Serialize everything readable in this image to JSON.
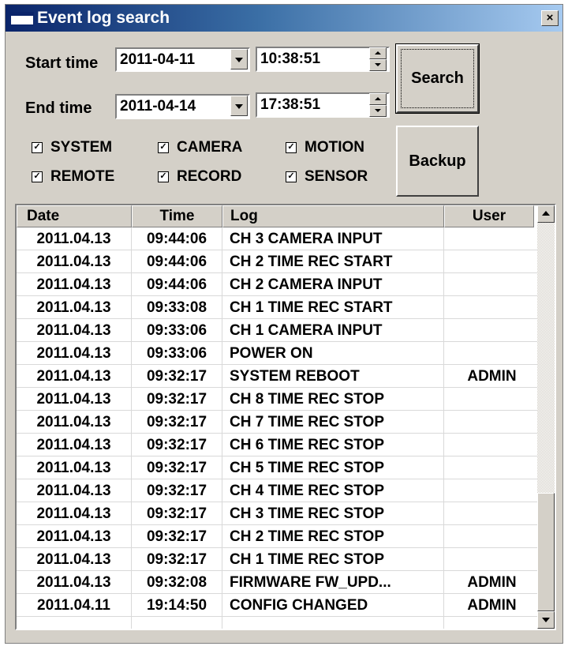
{
  "window": {
    "title": "Event log search",
    "close_label": "×"
  },
  "filters": {
    "start_label": "Start time",
    "start_date": "2011-04-11",
    "start_time": "10:38:51",
    "end_label": "End time",
    "end_date": "2011-04-14",
    "end_time": "17:38:51"
  },
  "buttons": {
    "search": "Search",
    "backup": "Backup"
  },
  "checkboxes": [
    {
      "label": "SYSTEM",
      "checked": true
    },
    {
      "label": "CAMERA",
      "checked": true
    },
    {
      "label": "MOTION",
      "checked": true
    },
    {
      "label": "REMOTE",
      "checked": true
    },
    {
      "label": "RECORD",
      "checked": true
    },
    {
      "label": "SENSOR",
      "checked": true
    }
  ],
  "table": {
    "columns": [
      "Date",
      "Time",
      "Log",
      "User"
    ],
    "rows": [
      [
        "2011.04.13",
        "09:44:06",
        "CH 3 CAMERA INPUT",
        ""
      ],
      [
        "2011.04.13",
        "09:44:06",
        "CH 2 TIME REC START",
        ""
      ],
      [
        "2011.04.13",
        "09:44:06",
        "CH 2 CAMERA INPUT",
        ""
      ],
      [
        "2011.04.13",
        "09:33:08",
        "CH 1 TIME REC START",
        ""
      ],
      [
        "2011.04.13",
        "09:33:06",
        "CH 1 CAMERA INPUT",
        ""
      ],
      [
        "2011.04.13",
        "09:33:06",
        "POWER ON",
        ""
      ],
      [
        "2011.04.13",
        "09:32:17",
        "SYSTEM REBOOT",
        "ADMIN"
      ],
      [
        "2011.04.13",
        "09:32:17",
        "CH 8 TIME REC STOP",
        ""
      ],
      [
        "2011.04.13",
        "09:32:17",
        "CH 7 TIME REC STOP",
        ""
      ],
      [
        "2011.04.13",
        "09:32:17",
        "CH 6 TIME REC STOP",
        ""
      ],
      [
        "2011.04.13",
        "09:32:17",
        "CH 5 TIME REC STOP",
        ""
      ],
      [
        "2011.04.13",
        "09:32:17",
        "CH 4 TIME REC STOP",
        ""
      ],
      [
        "2011.04.13",
        "09:32:17",
        "CH 3 TIME REC STOP",
        ""
      ],
      [
        "2011.04.13",
        "09:32:17",
        "CH 2 TIME REC STOP",
        ""
      ],
      [
        "2011.04.13",
        "09:32:17",
        "CH 1 TIME REC STOP",
        ""
      ],
      [
        "2011.04.13",
        "09:32:08",
        "FIRMWARE FW_UPD...",
        "ADMIN"
      ],
      [
        "2011.04.11",
        "19:14:50",
        "CONFIG CHANGED",
        "ADMIN"
      ],
      [
        "",
        "",
        "",
        ""
      ]
    ]
  },
  "scrollbar": {
    "position": 1.0
  }
}
